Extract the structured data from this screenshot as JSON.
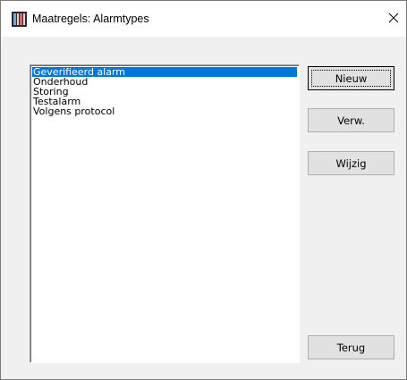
{
  "window": {
    "title": "Maatregels: Alarmtypes",
    "close_glyph": "✕"
  },
  "icons": {
    "app": "app-icon",
    "close": "close-icon"
  },
  "list": {
    "items": [
      {
        "label": "Geverifieerd alarm",
        "selected": true
      },
      {
        "label": "Onderhoud",
        "selected": false
      },
      {
        "label": "Storing",
        "selected": false
      },
      {
        "label": "Testalarm",
        "selected": false
      },
      {
        "label": "Volgens protocol",
        "selected": false
      }
    ]
  },
  "buttons": {
    "new_label": "Nieuw",
    "delete_label": "Verw.",
    "edit_label": "Wijzig",
    "back_label": "Terug"
  },
  "colors": {
    "selection": "#0078d7",
    "dialog_bg": "#f0f0f0",
    "button_bg": "#e1e1e1"
  }
}
